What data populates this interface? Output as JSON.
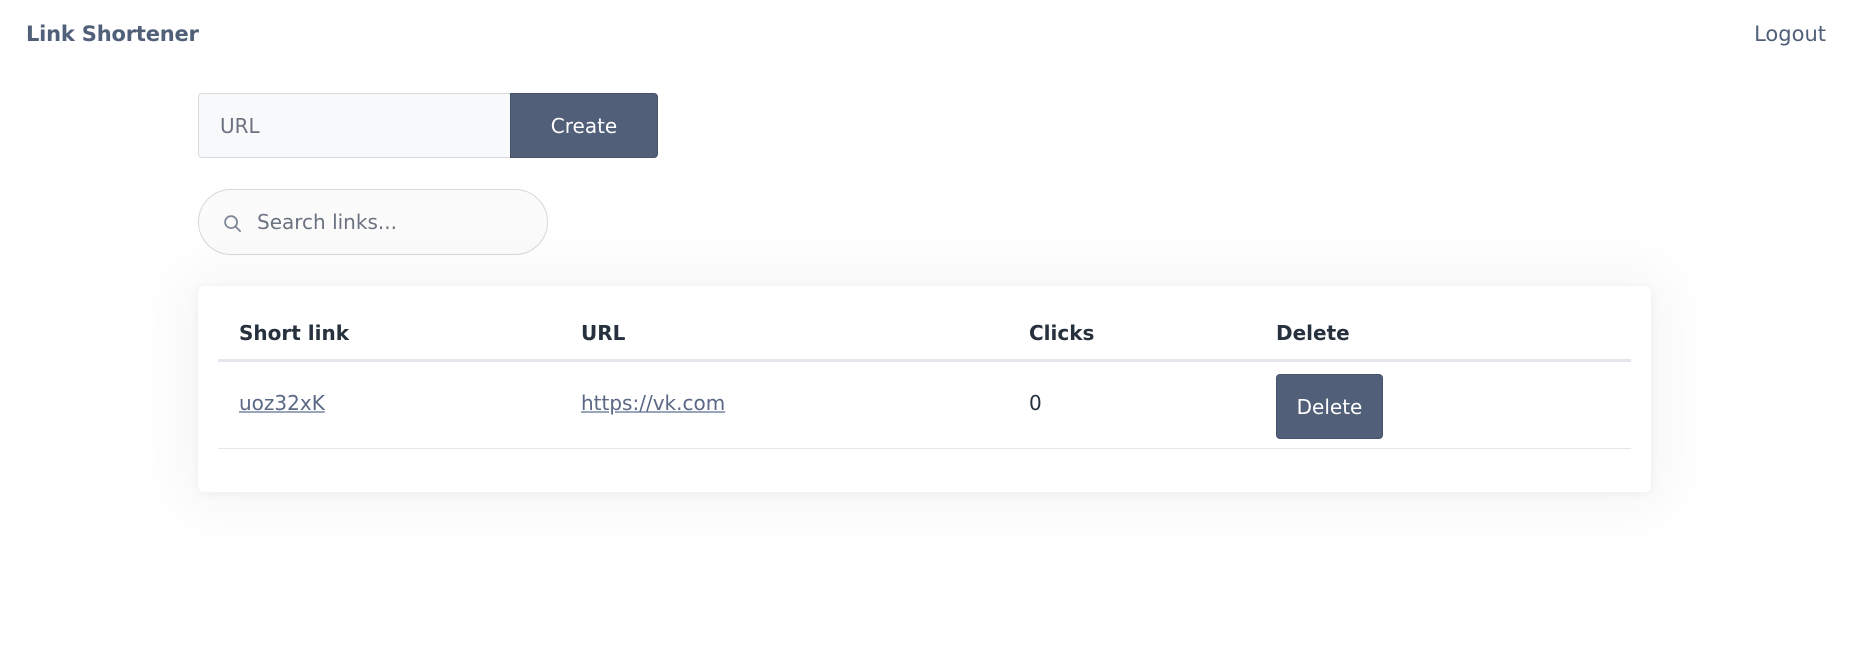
{
  "header": {
    "brand": "Link Shortener",
    "logout_label": "Logout"
  },
  "create_form": {
    "url_placeholder": "URL",
    "url_value": "",
    "create_label": "Create"
  },
  "search": {
    "placeholder": "Search links...",
    "value": "",
    "icon": "search-icon"
  },
  "table": {
    "headers": [
      "Short link",
      "URL",
      "Clicks",
      "Delete"
    ],
    "rows": [
      {
        "short_link": "uoz32xK",
        "url": "https://vk.com",
        "clicks": "0",
        "delete_label": "Delete"
      }
    ]
  },
  "colors": {
    "accent": "#525f79",
    "link": "#5a6886",
    "brand": "#516079"
  }
}
